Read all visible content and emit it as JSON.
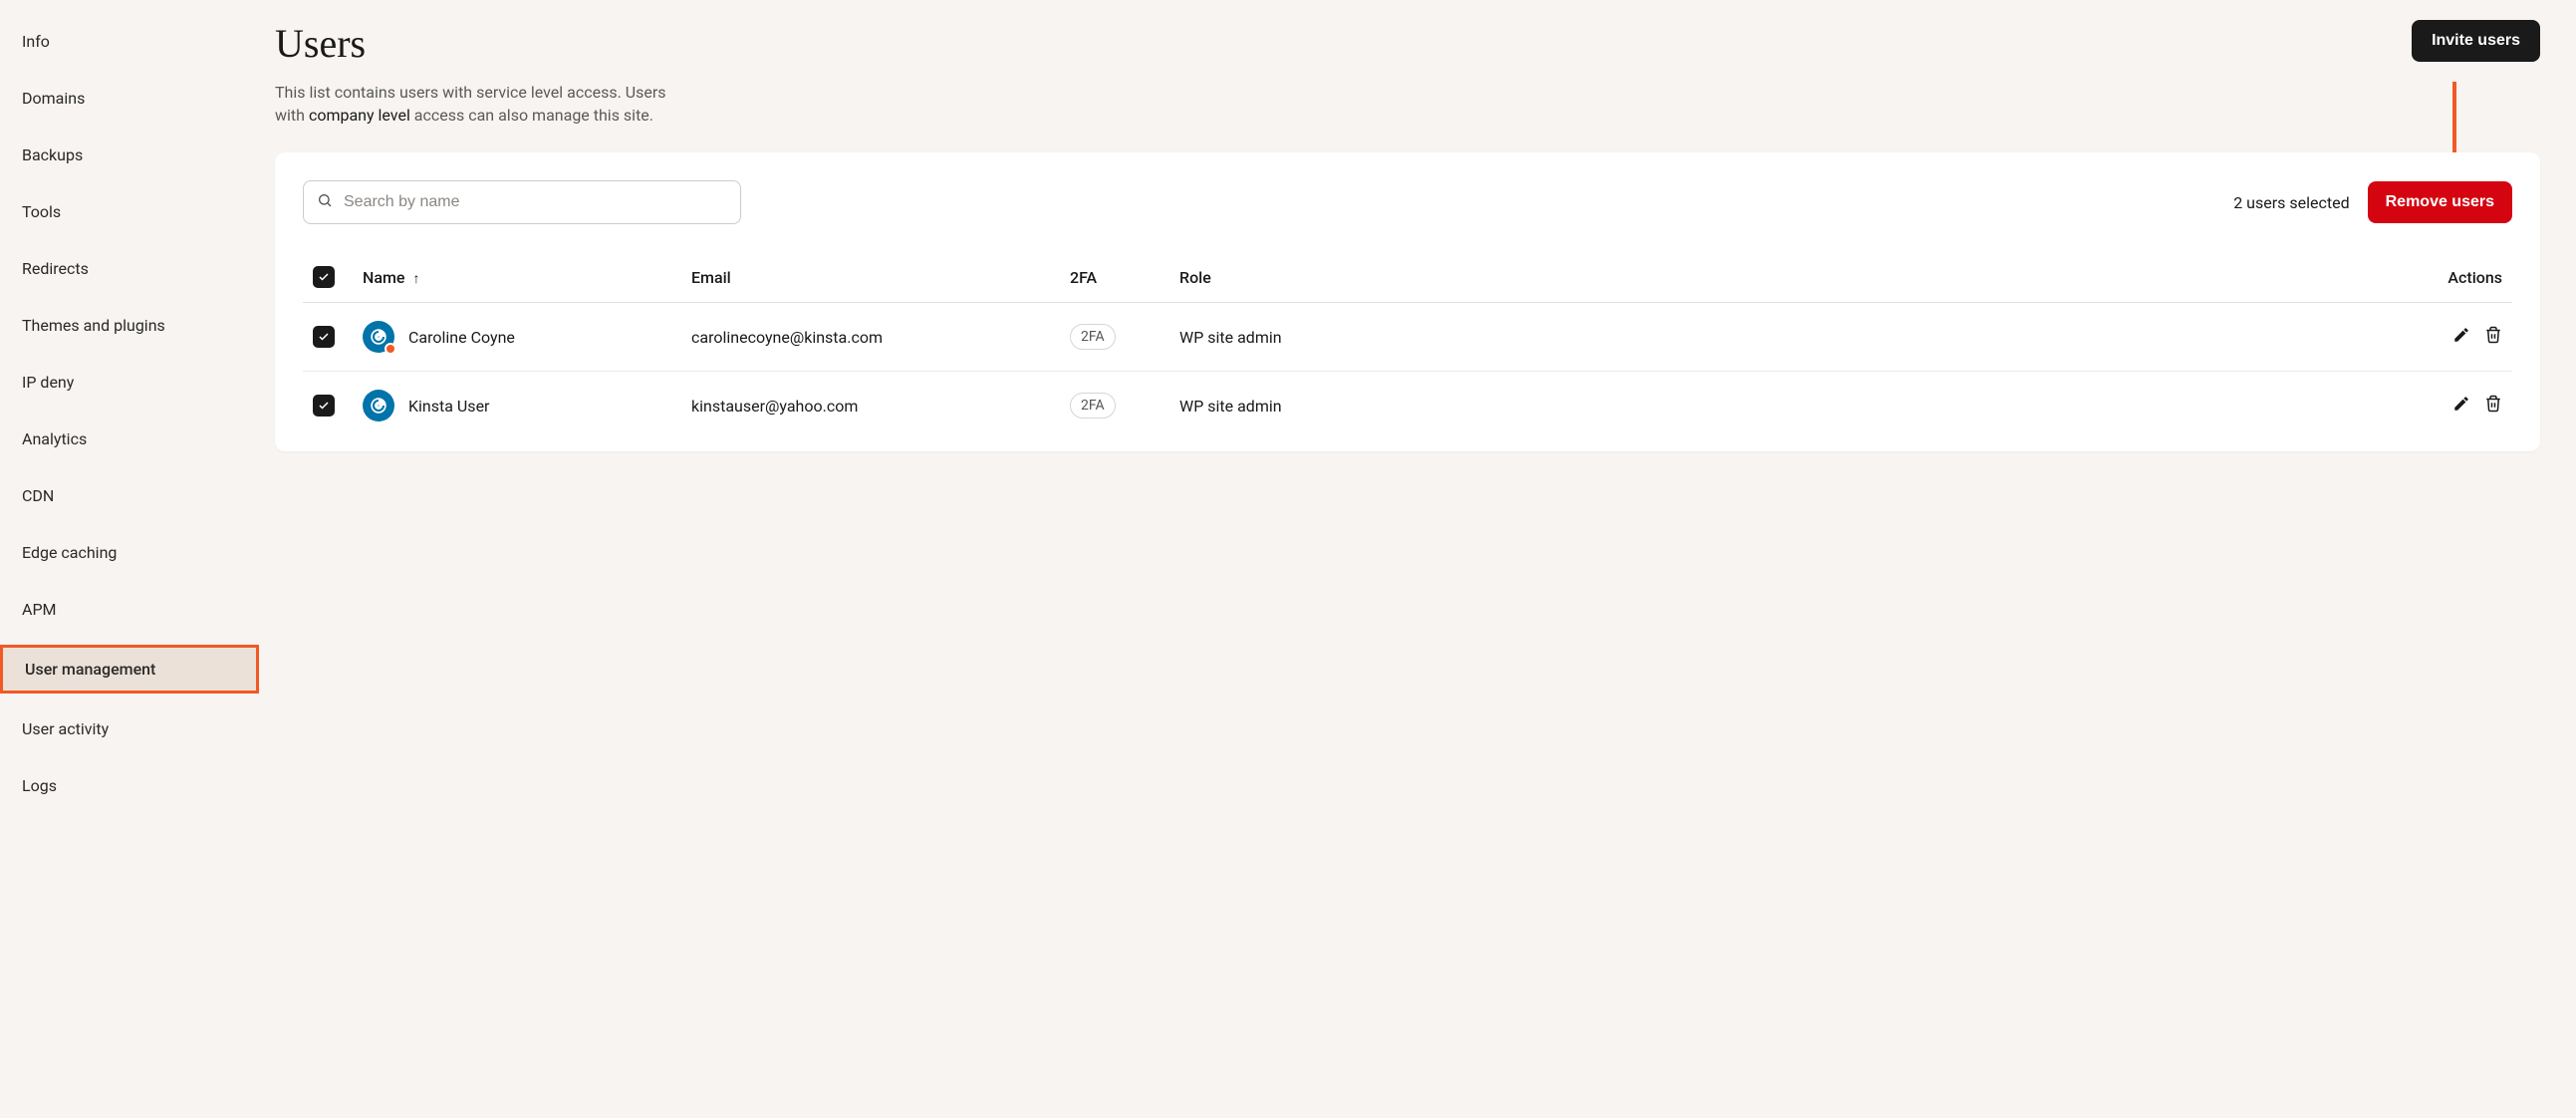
{
  "sidebar": {
    "items": [
      {
        "label": "Info"
      },
      {
        "label": "Domains"
      },
      {
        "label": "Backups"
      },
      {
        "label": "Tools"
      },
      {
        "label": "Redirects"
      },
      {
        "label": "Themes and plugins"
      },
      {
        "label": "IP deny"
      },
      {
        "label": "Analytics"
      },
      {
        "label": "CDN"
      },
      {
        "label": "Edge caching"
      },
      {
        "label": "APM"
      },
      {
        "label": "User management"
      },
      {
        "label": "User activity"
      },
      {
        "label": "Logs"
      }
    ],
    "active_index": 11
  },
  "header": {
    "title": "Users",
    "subtitle_pre": "This list contains users with service level access. Users with ",
    "company_level": "company level",
    "subtitle_post": " access can also manage this site.",
    "invite_label": "Invite users"
  },
  "toolbar": {
    "search_placeholder": "Search by name",
    "selected_text": "2 users selected",
    "remove_label": "Remove users"
  },
  "table": {
    "headers": {
      "name": "Name",
      "sort_arrow": "↑",
      "email": "Email",
      "twofa": "2FA",
      "role": "Role",
      "actions": "Actions"
    },
    "rows": [
      {
        "name": "Caroline Coyne",
        "email": "carolinecoyne@kinsta.com",
        "twofa": "2FA",
        "role": "WP site admin",
        "has_dot": true
      },
      {
        "name": "Kinsta User",
        "email": "kinstauser@yahoo.com",
        "twofa": "2FA",
        "role": "WP site admin",
        "has_dot": false
      }
    ]
  }
}
